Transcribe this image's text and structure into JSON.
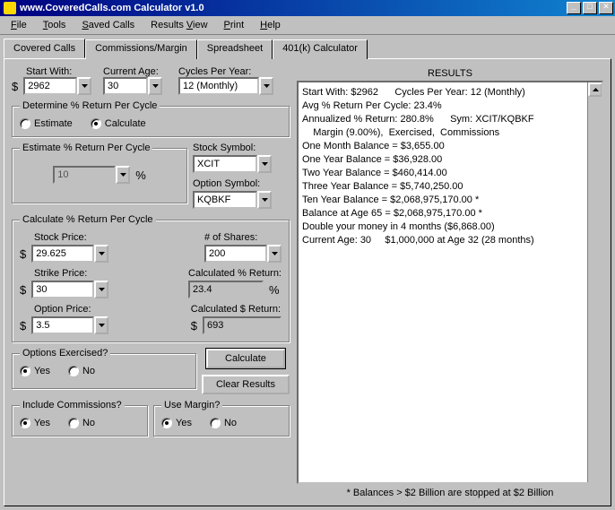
{
  "window": {
    "title": "www.CoveredCalls.com Calculator v1.0",
    "min": "_",
    "max": "□",
    "close": "✕"
  },
  "menu": {
    "file": "File",
    "tools": "Tools",
    "saved": "Saved Calls",
    "results": "Results View",
    "print": "Print",
    "help": "Help"
  },
  "tabs": {
    "covered": "Covered Calls",
    "comm": "Commissions/Margin",
    "spread": "Spreadsheet",
    "k401": "401(k) Calculator"
  },
  "labels": {
    "start_with": "Start With:",
    "current_age": "Current Age:",
    "cycles": "Cycles Per Year:",
    "determine_group": "Determine % Return Per Cycle",
    "estimate_radio": "Estimate",
    "calculate_radio": "Calculate",
    "estimate_group": "Estimate % Return Per Cycle",
    "stock_symbol": "Stock Symbol:",
    "option_symbol": "Option Symbol:",
    "calculate_group": "Calculate % Return Per Cycle",
    "stock_price": "Stock Price:",
    "num_shares": "# of Shares:",
    "strike_price": "Strike Price:",
    "calc_pct": "Calculated % Return:",
    "option_price": "Option Price:",
    "calc_dollar": "Calculated $ Return:",
    "exercised_group": "Options Exercised?",
    "include_comm_group": "Include Commissions?",
    "use_margin_group": "Use Margin?",
    "yes": "Yes",
    "no": "No",
    "calculate_btn": "Calculate",
    "clear_btn": "Clear Results",
    "results_header": "RESULTS",
    "footnote": "* Balances > $2 Billion are stopped at $2 Billion",
    "pct": "%",
    "dollar": "$"
  },
  "values": {
    "start_with": "2962",
    "current_age": "30",
    "cycles": "12 (Monthly)",
    "estimate_pct": "10",
    "stock_symbol": "XCIT",
    "option_symbol": "KQBKF",
    "stock_price": "29.625",
    "num_shares": "200",
    "strike_price": "30",
    "calc_pct": "23.4",
    "option_price": "3.5",
    "calc_dollar": "693"
  },
  "results": {
    "l1": "Start With: $2962      Cycles Per Year: 12 (Monthly)",
    "l2": "Avg % Return Per Cycle: 23.4%",
    "l3": "Annualized % Return: 280.8%      Sym: XCIT/KQBKF",
    "l4": "    Margin (9.00%),  Exercised,  Commissions",
    "l5": "One Month Balance = $3,655.00",
    "l6": "One Year Balance = $36,928.00",
    "l7": "Two Year Balance = $460,414.00",
    "l8": "Three Year Balance = $5,740,250.00",
    "l9": "Ten Year Balance = $2,068,975,170.00 *",
    "l10": "Balance at Age 65 = $2,068,975,170.00 *",
    "l11": "Double your money in 4 months ($6,868.00)",
    "l12": "Current Age: 30     $1,000,000 at Age 32 (28 months)"
  }
}
